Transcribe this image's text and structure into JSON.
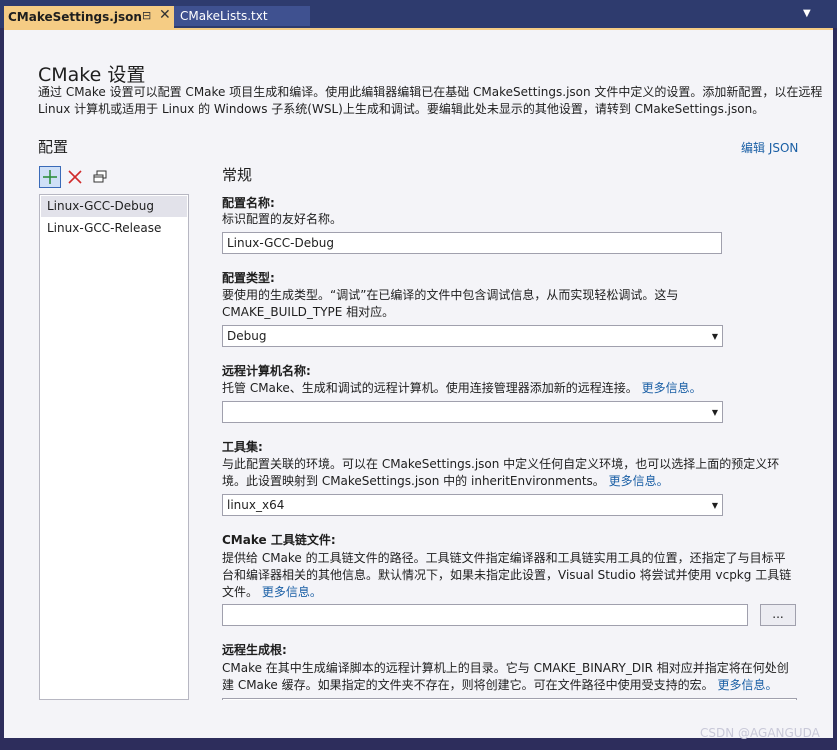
{
  "tabs": {
    "active_label": "CMakeSettings.json",
    "inactive_label": "CMakeLists.txt"
  },
  "page": {
    "title": "CMake 设置",
    "desc": "通过 CMake 设置可以配置 CMake 项目生成和编译。使用此编辑器编辑已在基础 CMakeSettings.json 文件中定义的设置。添加新配置，以在远程 Linux 计算机或适用于 Linux 的 Windows 子系统(WSL)上生成和调试。要编辑此处未显示的其他设置，请转到 CMakeSettings.json。",
    "section_title": "配置",
    "edit_json": "编辑 JSON"
  },
  "configs": {
    "items": [
      "Linux-GCC-Debug",
      "Linux-GCC-Release"
    ]
  },
  "form": {
    "heading": "常规",
    "config_name": {
      "label": "配置名称:",
      "desc": "标识配置的友好名称。",
      "value": "Linux-GCC-Debug"
    },
    "config_type": {
      "label": "配置类型:",
      "desc": "要使用的生成类型。“调试”在已编译的文件中包含调试信息，从而实现轻松调试。这与 CMAKE_BUILD_TYPE 相对应。",
      "value": "Debug"
    },
    "remote_machine": {
      "label": "远程计算机名称:",
      "desc": "托管 CMake、生成和调试的远程计算机。使用连接管理器添加新的远程连接。",
      "link": "更多信息。",
      "value": ""
    },
    "toolset": {
      "label": "工具集:",
      "desc": "与此配置关联的环境。可以在 CMakeSettings.json 中定义任何自定义环境，也可以选择上面的预定义环境。此设置映射到 CMakeSettings.json 中的 inheritEnvironments。",
      "link": "更多信息。",
      "value": "linux_x64"
    },
    "toolchain": {
      "label": "CMake 工具链文件:",
      "desc": "提供给 CMake 的工具链文件的路径。工具链文件指定编译器和工具链实用工具的位置，还指定了与目标平台和编译器相关的其他信息。默认情况下，如果未指定此设置，Visual Studio 将尝试并使用 vcpkg 工具链文件。",
      "link": "更多信息。",
      "value": "",
      "browse": "..."
    },
    "remote_build_root": {
      "label": "远程生成根:",
      "desc": "CMake 在其中生成编译脚本的远程计算机上的目录。它与 CMAKE_BINARY_DIR 相对应并指定将在何处创建 CMake 缓存。如果指定的文件夹不存在，则将创建它。可在文件路径中使用受支持的宏。",
      "link": "更多信息。"
    }
  },
  "watermark": "CSDN @AGANGUDA"
}
